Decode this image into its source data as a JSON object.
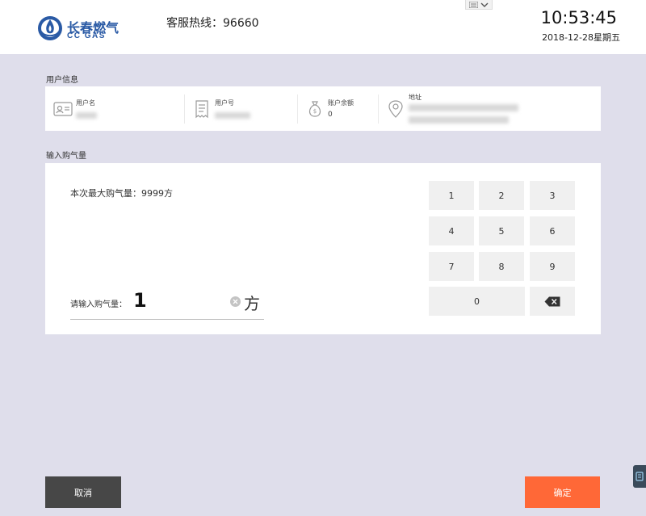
{
  "header": {
    "logo_cn": "长春燃气",
    "logo_en": "CC GAS",
    "hotline": "客服热线：96660",
    "time": "10:53:45",
    "date": "2018-12-28星期五"
  },
  "user_info": {
    "section_title": "用户信息",
    "items": [
      {
        "label": "用户名",
        "value": "",
        "icon": "id-card-icon"
      },
      {
        "label": "用户号",
        "value": "",
        "icon": "receipt-icon"
      },
      {
        "label": "账户余额",
        "value": "0",
        "icon": "money-bag-icon"
      },
      {
        "label": "地址",
        "value": "",
        "icon": "location-pin-icon"
      }
    ]
  },
  "purchase": {
    "section_title": "输入购气量",
    "max_text": "本次最大购气量：9999方",
    "input_label": "请输入购气量：",
    "input_value": "1",
    "unit": "方"
  },
  "keypad": {
    "keys": [
      "1",
      "2",
      "3",
      "4",
      "5",
      "6",
      "7",
      "8",
      "9",
      "0"
    ],
    "backspace_icon": "backspace-icon"
  },
  "buttons": {
    "cancel": "取消",
    "confirm": "确定"
  },
  "colors": {
    "background": "#dfdeeb",
    "brand": "#2a5aa5",
    "confirm": "#ff6837",
    "cancel": "#474747"
  }
}
